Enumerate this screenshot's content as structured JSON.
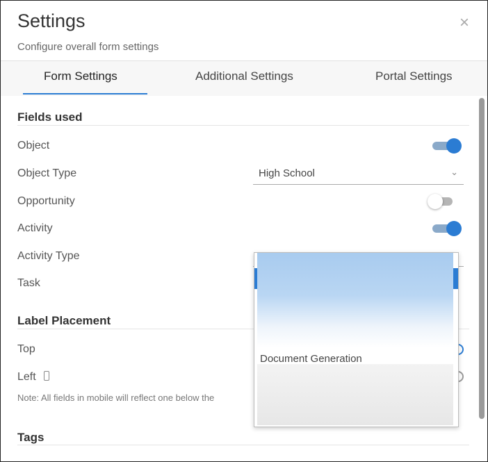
{
  "dialog": {
    "title": "Settings",
    "subtitle": "Configure overall form settings",
    "close_icon": "×"
  },
  "tabs": [
    {
      "label": "Form Settings",
      "active": true
    },
    {
      "label": "Additional Settings",
      "active": false
    },
    {
      "label": "Portal Settings",
      "active": false
    }
  ],
  "fields_used": {
    "title": "Fields used",
    "object": {
      "label": "Object",
      "enabled": true
    },
    "object_type": {
      "label": "Object Type",
      "value": "High School"
    },
    "opportunity": {
      "label": "Opportunity",
      "enabled": false
    },
    "activity": {
      "label": "Activity",
      "enabled": true
    },
    "activity_type": {
      "label": "Activity Type"
    },
    "task": {
      "label": "Task"
    }
  },
  "label_placement": {
    "title": "Label Placement",
    "top": {
      "label": "Top",
      "selected": true
    },
    "left": {
      "label": "Left",
      "selected": false
    },
    "note": "Note: All fields in mobile will reflect one below the"
  },
  "tags": {
    "title": "Tags"
  },
  "dropdown": {
    "item_label": "Document Generation"
  },
  "icons": {
    "close": "close-icon",
    "chevron": "chevron-down-icon",
    "mobile": "mobile-phone-icon"
  },
  "colors": {
    "accent": "#2b7cd3"
  }
}
